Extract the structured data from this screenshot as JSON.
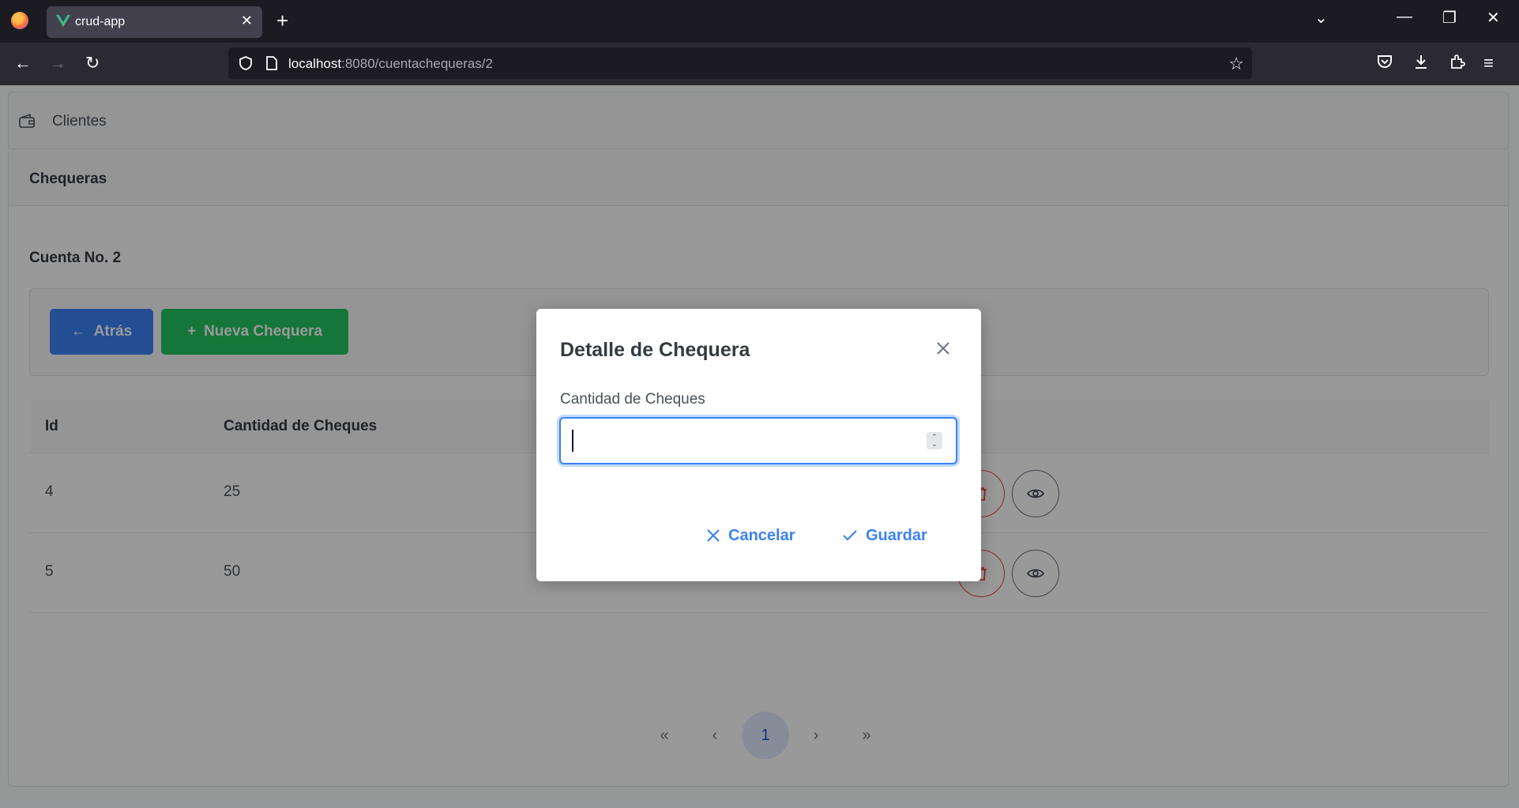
{
  "browser": {
    "tab_title": "crud-app",
    "url_host": "localhost",
    "url_rest": ":8080/cuentachequeras/2"
  },
  "menu": {
    "item_label": "Clientes"
  },
  "card": {
    "header_title": "Chequeras",
    "account_title": "Cuenta No. 2"
  },
  "toolbar": {
    "back_label": "Atrás",
    "new_label": "Nueva Chequera"
  },
  "table": {
    "columns": [
      "Id",
      "Cantidad de Cheques"
    ],
    "rows": [
      {
        "id": "4",
        "cantidad": "25"
      },
      {
        "id": "5",
        "cantidad": "50"
      }
    ]
  },
  "pager": {
    "current_page": "1"
  },
  "dialog": {
    "title": "Detalle de Chequera",
    "field_label": "Cantidad de Cheques",
    "field_value": "",
    "cancel_label": "Cancelar",
    "save_label": "Guardar"
  },
  "colors": {
    "primary": "#3b82f6",
    "success": "#22c55e",
    "danger": "#ef4444"
  }
}
